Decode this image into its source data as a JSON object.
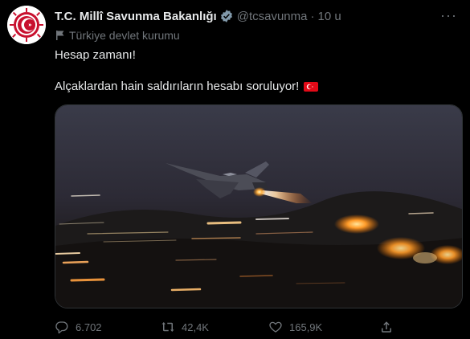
{
  "account": {
    "name": "T.C. Millî Savunma Bakanlığı",
    "handle": "@tcsavunma",
    "separator": "·",
    "time": "10 u",
    "label": "Türkiye devlet kurumu"
  },
  "tweet": {
    "line1": "Hesap zamanı!",
    "line2": "Alçaklardan hain saldırıların hesabı soruluyor!"
  },
  "metrics": {
    "replies": "6.702",
    "retweets": "42,4K",
    "likes": "165,9K"
  },
  "colors": {
    "background": "#000000",
    "text": "#e7e9ea",
    "muted": "#71767b",
    "verified": "#829aab",
    "flag_red": "#e30a17"
  },
  "icons": [
    "emblem-avatar",
    "verified-badge-icon",
    "more-icon",
    "government-flag-icon",
    "turkish-flag-emoji",
    "reply-icon",
    "retweet-icon",
    "like-icon",
    "share-icon"
  ]
}
